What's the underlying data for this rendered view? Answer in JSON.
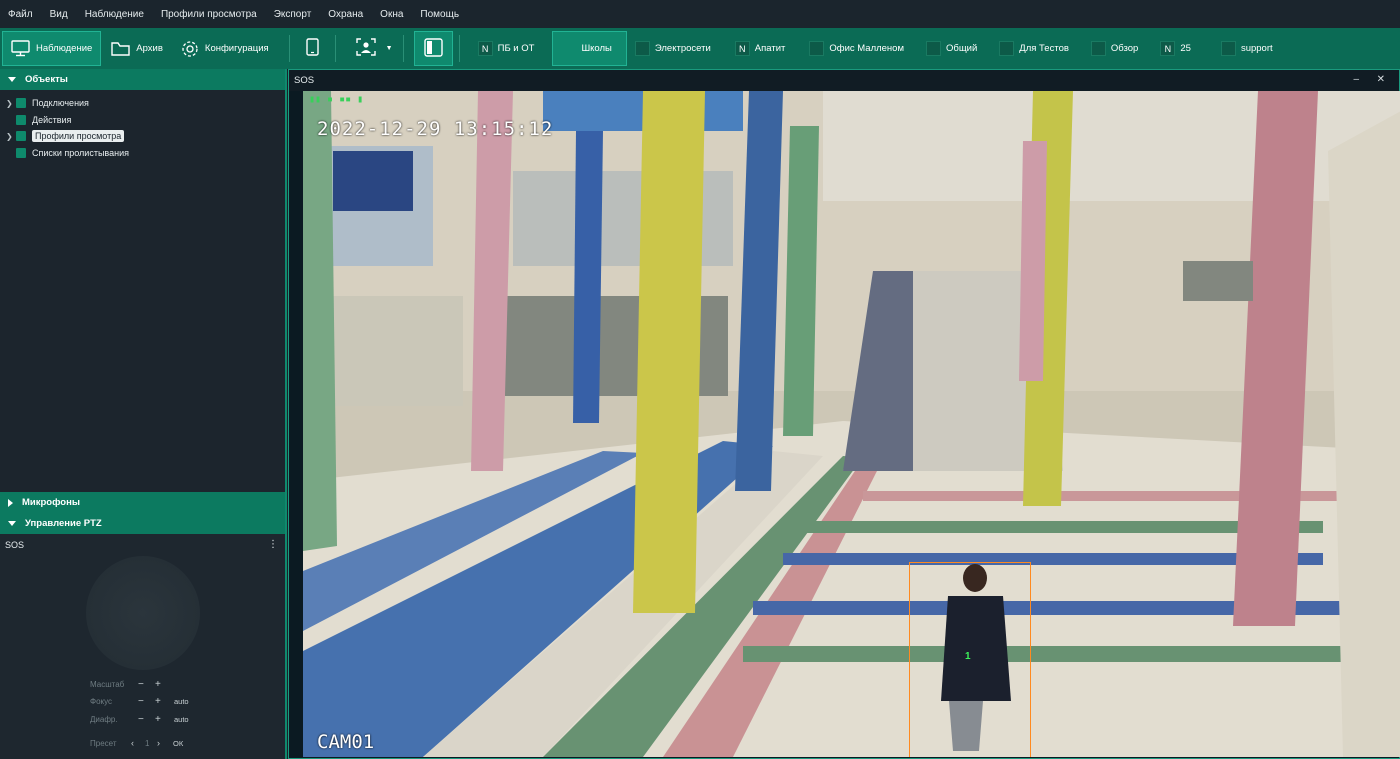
{
  "menu": [
    "Файл",
    "Вид",
    "Наблюдение",
    "Профили просмотра",
    "Экспорт",
    "Охрана",
    "Окна",
    "Помощь"
  ],
  "toolbar": {
    "modes": [
      {
        "label": "Наблюдение",
        "icon": "monitor-icon",
        "active": true
      },
      {
        "label": "Архив",
        "icon": "folder-icon",
        "active": false
      },
      {
        "label": "Конфигурация",
        "icon": "gear-icon",
        "active": false
      }
    ],
    "profiles": [
      {
        "badge": "N",
        "label": "ПБ и ОТ",
        "active": false
      },
      {
        "badge": "",
        "label": "Школы",
        "active": true
      },
      {
        "badge": "",
        "label": "Электросети",
        "active": false
      },
      {
        "badge": "N",
        "label": "Апатит",
        "active": false
      },
      {
        "badge": "",
        "label": "Офис Малленом",
        "active": false
      },
      {
        "badge": "",
        "label": "Общий",
        "active": false
      },
      {
        "badge": "",
        "label": "Для Тестов",
        "active": false
      },
      {
        "badge": "",
        "label": "Обзор",
        "active": false
      },
      {
        "badge": "N",
        "label": "25",
        "active": false
      },
      {
        "badge": "",
        "label": "support",
        "active": false
      }
    ]
  },
  "sidebar": {
    "objects_title": "Объекты",
    "tree": [
      {
        "label": "Подключения",
        "arrow": true,
        "selected": false
      },
      {
        "label": "Действия",
        "arrow": false,
        "selected": false
      },
      {
        "label": "Профили просмотра",
        "arrow": true,
        "selected": true
      },
      {
        "label": "Списки пролистывания",
        "arrow": false,
        "selected": false
      }
    ],
    "microphones_title": "Микрофоны",
    "ptz_title": "Управление PTZ",
    "ptz": {
      "camera": "SOS",
      "zoom_label": "Масштаб",
      "focus_label": "Фокус",
      "focus_value": "auto",
      "aperture_label": "Диафр.",
      "aperture_value": "auto",
      "preset_label": "Пресет",
      "preset_value": "1",
      "preset_ok": "ОК"
    }
  },
  "viewer": {
    "title": "SOS",
    "timestamp": "2022-12-29 13:15:12",
    "camera_name": "CAM01",
    "track_id": "1"
  },
  "colors": {
    "toolbar": "#0b6b55",
    "accent": "#0f8a6e",
    "panel": "#1c252d",
    "track_box": "#ff8a20"
  }
}
